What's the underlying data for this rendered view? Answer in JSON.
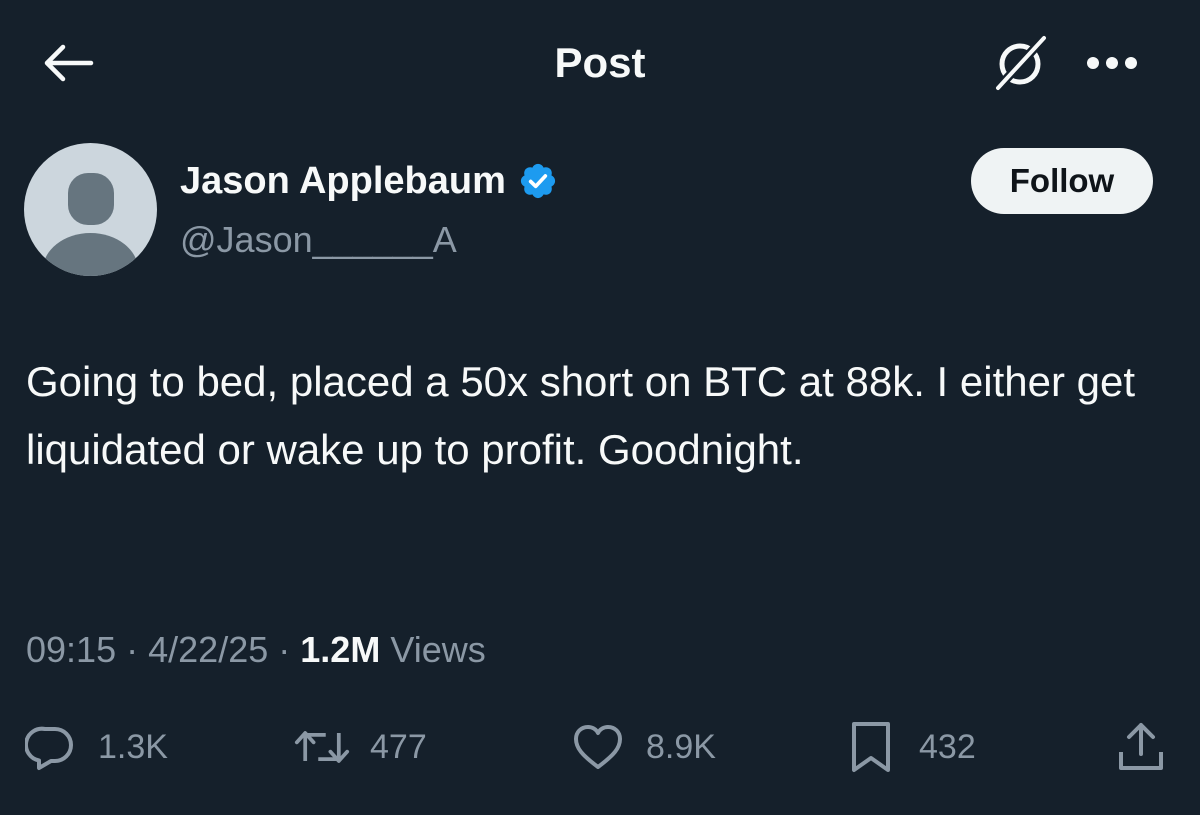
{
  "header": {
    "title": "Post",
    "icons": {
      "back": "arrow-left-icon",
      "grok": "grok-icon",
      "more": "more-horizontal-icon"
    }
  },
  "author": {
    "name": "Jason Applebaum",
    "handle": "@Jason______A",
    "verified": true,
    "verified_color": "#1d9bf0",
    "follow_label": "Follow"
  },
  "post": {
    "text": "Going to bed, placed a 50x short on BTC at 88k. I either get liquidated or wake up to profit. Goodnight."
  },
  "meta": {
    "time": "09:15",
    "separator": "·",
    "date": "4/22/25",
    "views_count": "1.2M",
    "views_label": "Views"
  },
  "actions": {
    "replies": "1.3K",
    "reposts": "477",
    "likes": "8.9K",
    "bookmarks": "432"
  },
  "colors": {
    "background": "#15202b",
    "text_primary": "#f7f9f9",
    "text_secondary": "#8b98a5",
    "follow_bg": "#eff3f4"
  }
}
